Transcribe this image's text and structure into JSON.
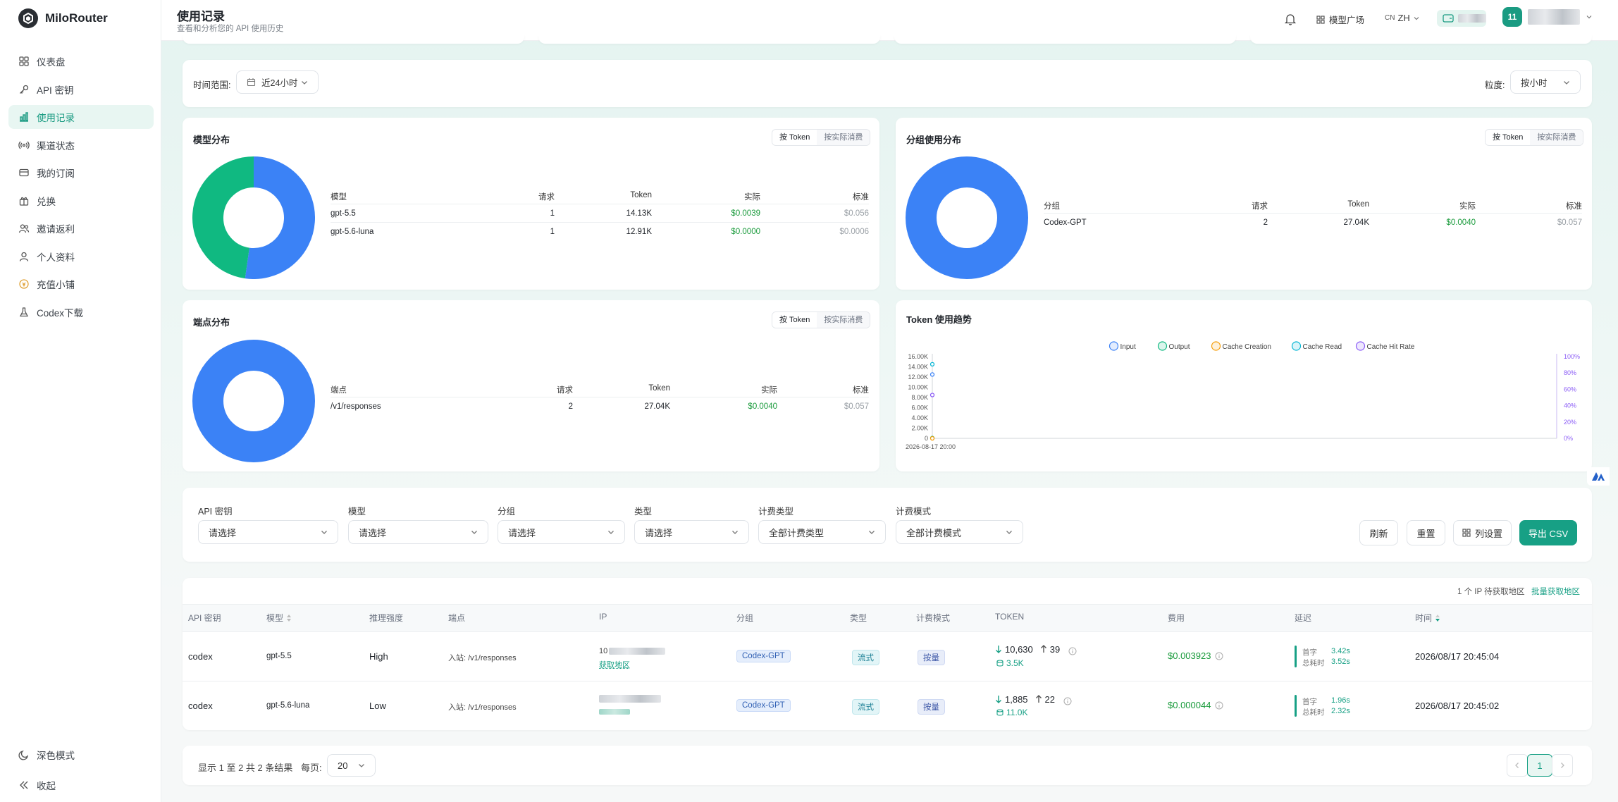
{
  "app": {
    "name": "MiloRouter"
  },
  "sidebar": {
    "items": [
      {
        "label": "仪表盘",
        "icon": "grid-icon"
      },
      {
        "label": "API 密钥",
        "icon": "key-icon"
      },
      {
        "label": "使用记录",
        "icon": "bar-chart-icon",
        "active": true
      },
      {
        "label": "渠道状态",
        "icon": "signal-icon"
      },
      {
        "label": "我的订阅",
        "icon": "card-icon"
      },
      {
        "label": "兑换",
        "icon": "gift-icon"
      },
      {
        "label": "邀请返利",
        "icon": "users-icon"
      },
      {
        "label": "个人资料",
        "icon": "user-icon"
      },
      {
        "label": "充值小铺",
        "icon": "coin-icon"
      },
      {
        "label": "Codex下载",
        "icon": "flask-icon"
      }
    ],
    "bottom": [
      {
        "label": "深色模式",
        "icon": "moon-icon"
      },
      {
        "label": "收起",
        "icon": "collapse-icon"
      }
    ]
  },
  "header": {
    "title": "使用记录",
    "subtitle": "查看和分析您的 API 使用历史",
    "model_market": "模型广场",
    "lang_code": "CN",
    "lang": "ZH",
    "avatar": "11"
  },
  "filters_top": {
    "time_label": "时间范围:",
    "time_value": "近24小时",
    "granularity_label": "粒度:",
    "granularity_value": "按小时"
  },
  "model_dist": {
    "title": "模型分布",
    "seg": [
      "按 Token",
      "按实际消费"
    ],
    "headers": [
      "模型",
      "请求",
      "Token",
      "实际",
      "标准"
    ],
    "rows": [
      {
        "name": "gpt-5.5",
        "req": "1",
        "token": "14.13K",
        "actual": "$0.0039",
        "standard": "$0.056"
      },
      {
        "name": "gpt-5.6-luna",
        "req": "1",
        "token": "12.91K",
        "actual": "$0.0000",
        "standard": "$0.0006"
      }
    ],
    "donut": [
      {
        "label": "gpt-5.5",
        "value": 14.13,
        "color": "#3b82f6"
      },
      {
        "label": "gpt-5.6-luna",
        "value": 12.91,
        "color": "#10b981"
      }
    ]
  },
  "group_dist": {
    "title": "分组使用分布",
    "seg": [
      "按 Token",
      "按实际消费"
    ],
    "headers": [
      "分组",
      "请求",
      "Token",
      "实际",
      "标准"
    ],
    "rows": [
      {
        "name": "Codex-GPT",
        "req": "2",
        "token": "27.04K",
        "actual": "$0.0040",
        "standard": "$0.057"
      }
    ]
  },
  "endpoint_dist": {
    "title": "端点分布",
    "seg": [
      "按 Token",
      "按实际消费"
    ],
    "headers": [
      "端点",
      "请求",
      "Token",
      "实际",
      "标准"
    ],
    "rows": [
      {
        "name": "/v1/responses",
        "req": "2",
        "token": "27.04K",
        "actual": "$0.0040",
        "standard": "$0.057"
      }
    ]
  },
  "chart_data": {
    "type": "line",
    "title": "Token 使用趋势",
    "legend": [
      "Input",
      "Output",
      "Cache Creation",
      "Cache Read",
      "Cache Hit Rate"
    ],
    "legend_colors": [
      "#3b82f6",
      "#10b981",
      "#f59e0b",
      "#06b6d4",
      "#8b5cf6"
    ],
    "legend_position": "top",
    "x": [
      "2026-08-17 20:00"
    ],
    "y_ticks_left": [
      "16.00K",
      "14.00K",
      "12.00K",
      "10.00K",
      "8.00K",
      "6.00K",
      "4.00K",
      "2.00K",
      "0"
    ],
    "y_ticks_right": [
      "100%",
      "80%",
      "60%",
      "40%",
      "20%",
      "0%"
    ],
    "ylim": [
      0,
      16000
    ],
    "series": [
      {
        "name": "Input",
        "values": [
          12500
        ]
      },
      {
        "name": "Output",
        "values": [
          61
        ]
      },
      {
        "name": "Cache Creation",
        "values": [
          0
        ]
      },
      {
        "name": "Cache Read",
        "values": [
          14500
        ]
      },
      {
        "name": "Cache Hit Rate",
        "values": [
          53
        ]
      }
    ]
  },
  "filters": {
    "fields": [
      {
        "label": "API 密钥",
        "value": "请选择"
      },
      {
        "label": "模型",
        "value": "请选择"
      },
      {
        "label": "分组",
        "value": "请选择"
      },
      {
        "label": "类型",
        "value": "请选择"
      },
      {
        "label": "计费类型",
        "value": "全部计费类型"
      },
      {
        "label": "计费模式",
        "value": "全部计费模式"
      }
    ],
    "refresh": "刷新",
    "reset": "重置",
    "columns": "列设置",
    "export": "导出 CSV"
  },
  "records": {
    "ip_pending": "1 个 IP 待获取地区",
    "batch_fetch": "批量获取地区",
    "headers": [
      "API 密钥",
      "模型",
      "推理强度",
      "端点",
      "IP",
      "分组",
      "类型",
      "计费模式",
      "TOKEN",
      "费用",
      "延迟",
      "时间"
    ],
    "rows": [
      {
        "key": "codex",
        "model": "gpt-5.5",
        "effort": "High",
        "endpoint": "入站: /v1/responses",
        "ip_prefix": "10",
        "ip_link": "获取地区",
        "group": "Codex-GPT",
        "type": "流式",
        "billing": "按量",
        "tok_in": "10,630",
        "tok_out": "39",
        "tok_cache": "3.5K",
        "cost": "$0.003923",
        "first_label": "首字",
        "first": "3.42s",
        "total_label": "总耗时",
        "total": "3.52s",
        "time": "2026/08/17 20:45:04"
      },
      {
        "key": "codex",
        "model": "gpt-5.6-luna",
        "effort": "Low",
        "endpoint": "入站: /v1/responses",
        "ip_prefix": "",
        "ip_link": "",
        "group": "Codex-GPT",
        "type": "流式",
        "billing": "按量",
        "tok_in": "1,885",
        "tok_out": "22",
        "tok_cache": "11.0K",
        "cost": "$0.000044",
        "first_label": "首字",
        "first": "1.96s",
        "total_label": "总耗时",
        "total": "2.32s",
        "time": "2026/08/17 20:45:02"
      }
    ]
  },
  "pagination": {
    "summary": "显示 1 至 2 共 2 条结果",
    "per_page_label": "每页:",
    "per_page": "20",
    "current": "1"
  }
}
